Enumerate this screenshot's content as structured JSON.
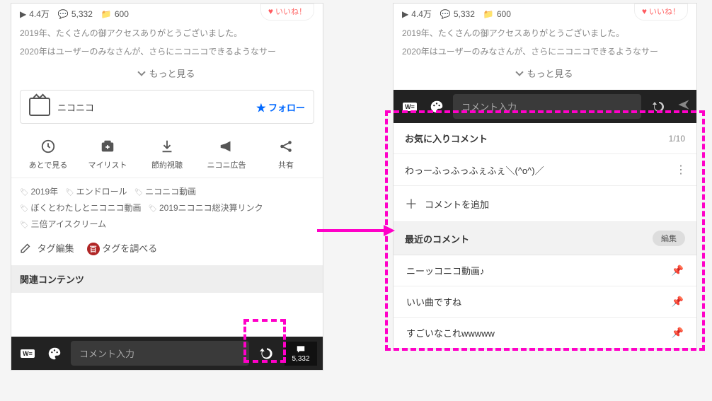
{
  "stats": {
    "plays": "4.4万",
    "comments": "5,332",
    "mylists": "600"
  },
  "like_label": "いいね！",
  "desc_line1": "2019年、たくさんの御アクセスありがとうございました。",
  "desc_line2": "2020年はユーザーのみなさんが、さらにニコニコできるようなサー",
  "see_more": "もっと見る",
  "channel": {
    "name": "ニコニコ",
    "follow": "フォロー"
  },
  "actions": {
    "later": "あとで見る",
    "mylist": "マイリスト",
    "saver": "節約視聴",
    "ad": "ニコニ広告",
    "share": "共有"
  },
  "tags": [
    "2019年",
    "エンドロール",
    "ニコニコ動画",
    "ぼくとわたしとニコニコ動画",
    "2019ニコニコ総決算リンク",
    "三倍アイスクリーム"
  ],
  "tag_edit": "タグ編集",
  "tag_search": "タグを調べる",
  "related": "関連コンテンツ",
  "comment_placeholder": "コメント入力",
  "comment_count": "5,332",
  "fav": {
    "header": "お気に入りコメント",
    "count": "1/10",
    "item1": "わっーふっふっふぇふぇ＼(^o^)／",
    "add": "コメントを追加"
  },
  "recent": {
    "header": "最近のコメント",
    "edit": "編集",
    "items": [
      "ニーッコニコ動画♪",
      "いい曲ですね",
      "すごいなこれwwwww"
    ]
  }
}
